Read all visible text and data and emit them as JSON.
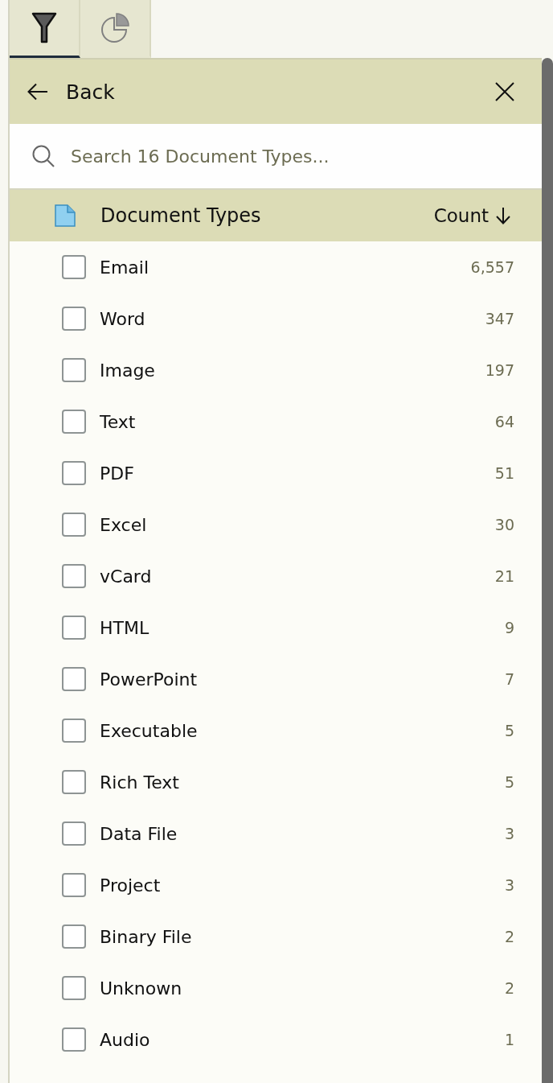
{
  "tabs": [
    {
      "kind": "filter",
      "selected": true
    },
    {
      "kind": "chart",
      "selected": false
    }
  ],
  "panel_header": {
    "back_label": "Back"
  },
  "search": {
    "placeholder": "Search 16 Document Types..."
  },
  "list_header": {
    "title": "Document Types",
    "sort_label": "Count"
  },
  "items": [
    {
      "label": "Email",
      "count": "6,557",
      "checked": false
    },
    {
      "label": "Word",
      "count": "347",
      "checked": false
    },
    {
      "label": "Image",
      "count": "197",
      "checked": false
    },
    {
      "label": "Text",
      "count": "64",
      "checked": false
    },
    {
      "label": "PDF",
      "count": "51",
      "checked": false
    },
    {
      "label": "Excel",
      "count": "30",
      "checked": false
    },
    {
      "label": "vCard",
      "count": "21",
      "checked": false
    },
    {
      "label": "HTML",
      "count": "9",
      "checked": false
    },
    {
      "label": "PowerPoint",
      "count": "7",
      "checked": false
    },
    {
      "label": "Executable",
      "count": "5",
      "checked": false
    },
    {
      "label": "Rich Text",
      "count": "5",
      "checked": false
    },
    {
      "label": "Data File",
      "count": "3",
      "checked": false
    },
    {
      "label": "Project",
      "count": "3",
      "checked": false
    },
    {
      "label": "Binary File",
      "count": "2",
      "checked": false
    },
    {
      "label": "Unknown",
      "count": "2",
      "checked": false
    },
    {
      "label": "Audio",
      "count": "1",
      "checked": false
    }
  ]
}
